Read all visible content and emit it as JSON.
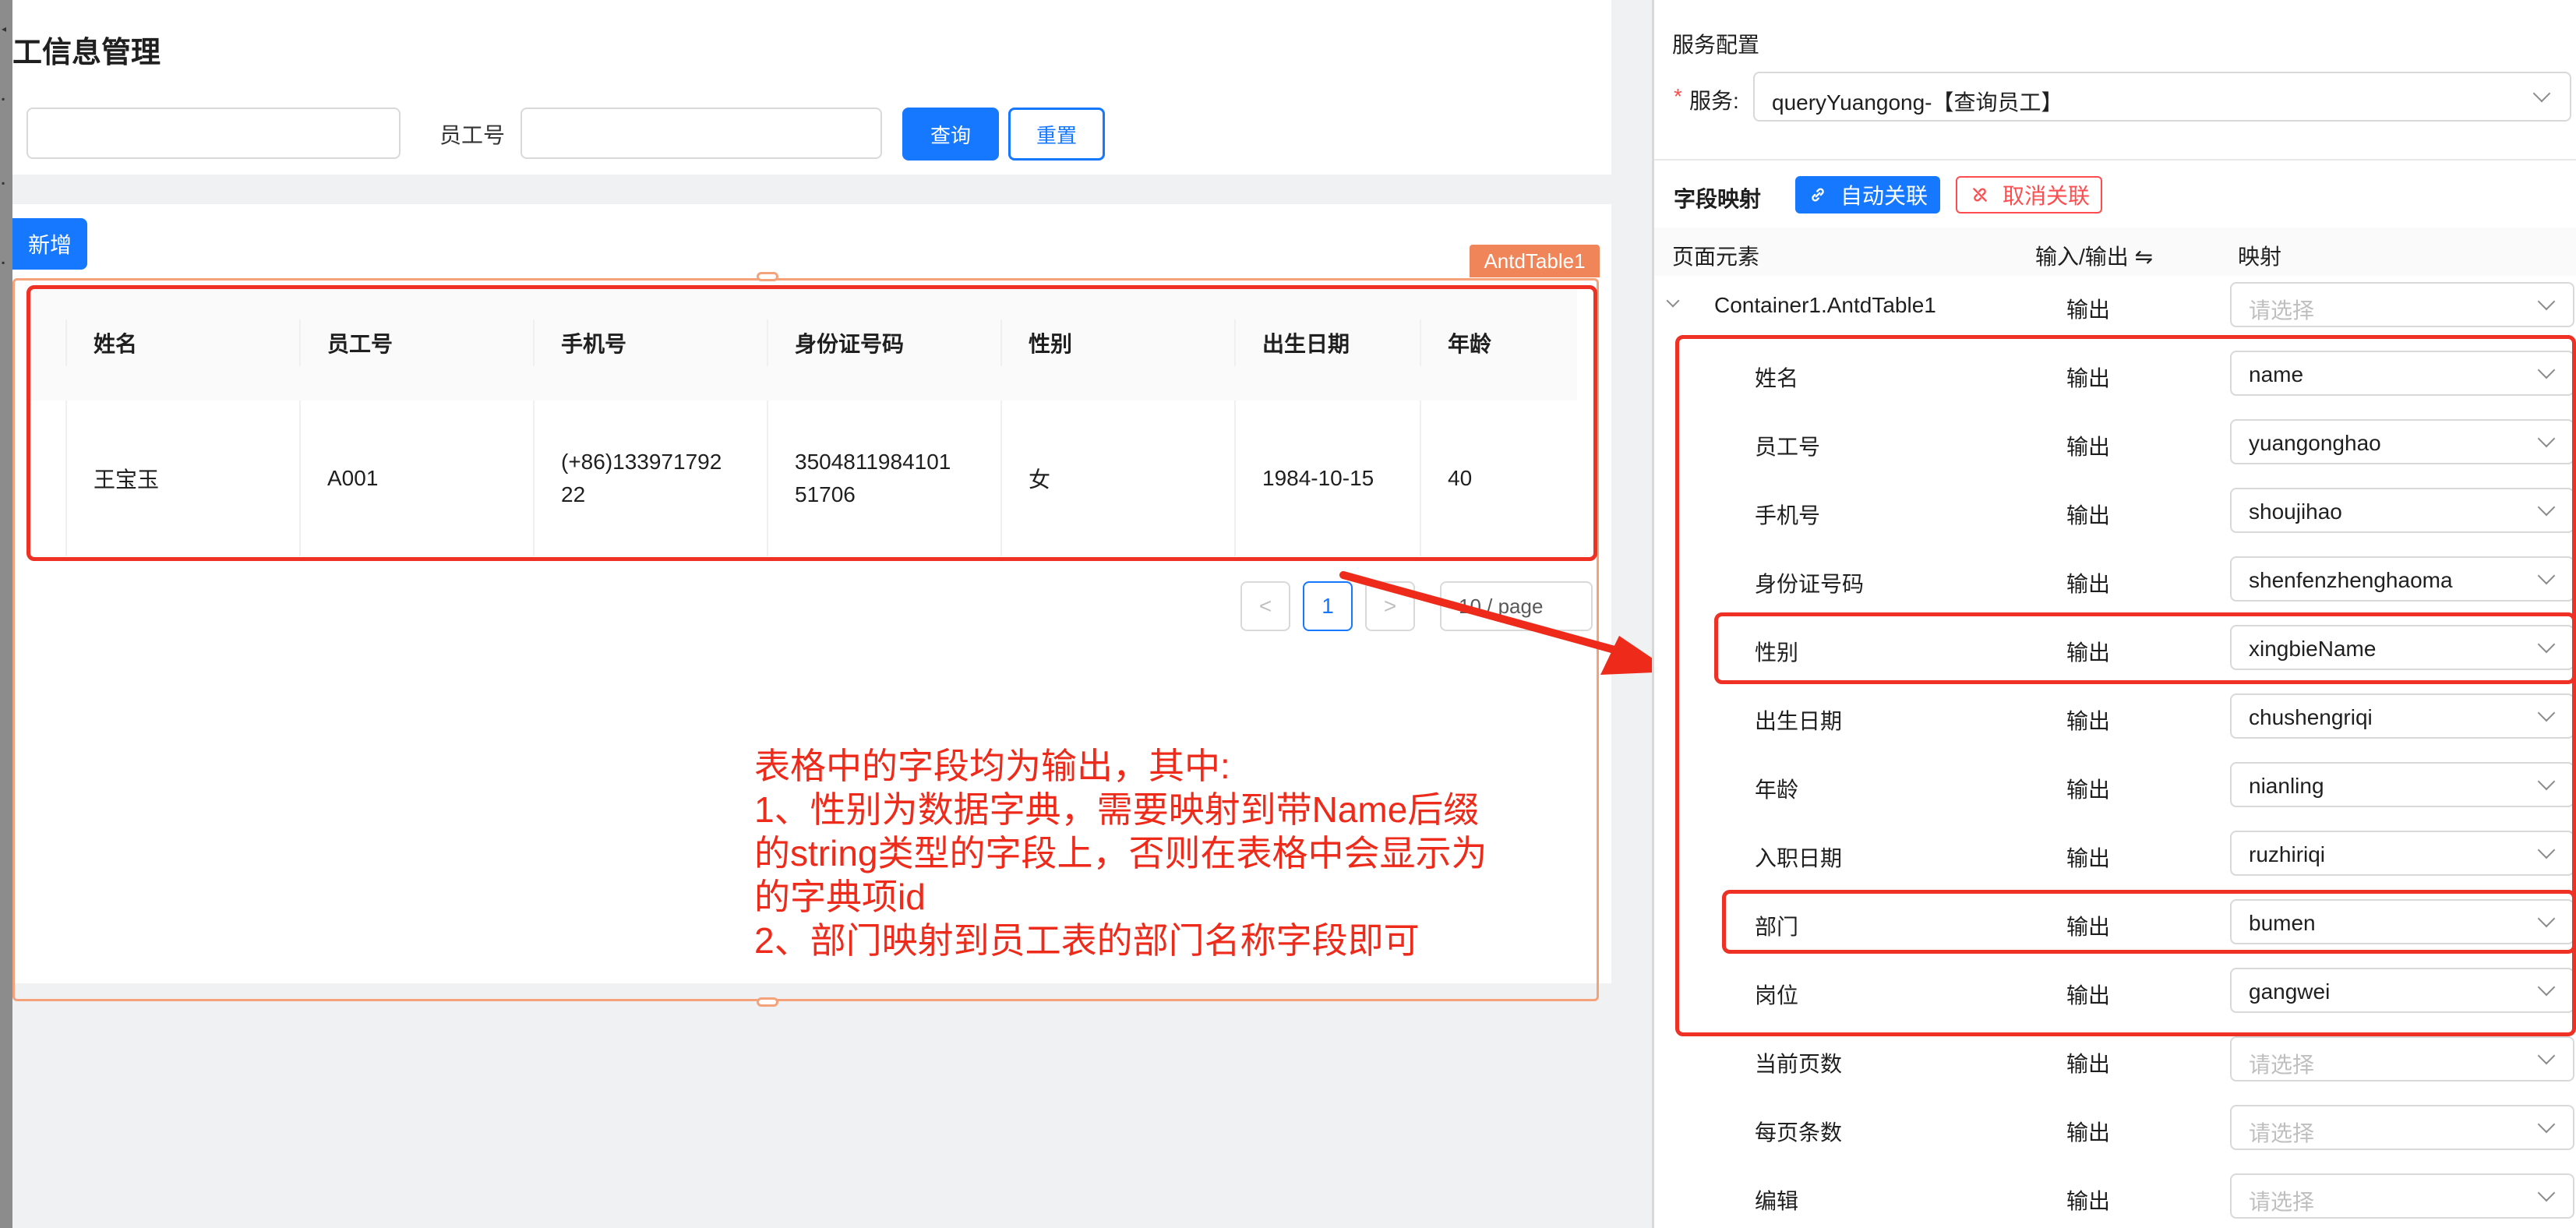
{
  "page": {
    "title": "工信息管理",
    "search": {
      "employee_no_label": "员工号",
      "query_button": "查询",
      "reset_button": "重置"
    },
    "new_button": "新增",
    "component_tag": "AntdTable1",
    "table": {
      "columns": [
        "姓名",
        "员工号",
        "手机号",
        "身份证号码",
        "性别",
        "出生日期",
        "年龄"
      ],
      "rows": [
        [
          "王宝玉",
          "A001",
          "(+86)133971792\n22",
          "3504811984101\n51706",
          "女",
          "1984-10-15",
          "40"
        ]
      ]
    },
    "pagination": {
      "prev": "<",
      "current": "1",
      "next": ">",
      "page_size": "10 / page"
    }
  },
  "annotation": {
    "text": "表格中的字段均为输出，其中:\n1、性别为数据字典，需要映射到带Name后缀\n的string类型的字段上，否则在表格中会显示为\n的字典项id\n2、部门映射到员工表的部门名称字段即可"
  },
  "panel": {
    "service_config_title": "服务配置",
    "service_label": "服务:",
    "service_required": "*",
    "service_value": "queryYuangong-【查询员工】",
    "field_mapping_title": "字段映射",
    "auto_link_button": "自动关联",
    "cancel_link_button": "取消关联",
    "headers": {
      "element": "页面元素",
      "io": "输入/输出 ⇋",
      "mapping": "映射"
    },
    "root": {
      "name": "Container1.AntdTable1",
      "io": "输出",
      "mapping": "请选择"
    },
    "rows": [
      {
        "name": "姓名",
        "io": "输出",
        "mapping": "name"
      },
      {
        "name": "员工号",
        "io": "输出",
        "mapping": "yuangonghao"
      },
      {
        "name": "手机号",
        "io": "输出",
        "mapping": "shoujihao"
      },
      {
        "name": "身份证号码",
        "io": "输出",
        "mapping": "shenfenzhenghaoma"
      },
      {
        "name": "性别",
        "io": "输出",
        "mapping": "xingbieName"
      },
      {
        "name": "出生日期",
        "io": "输出",
        "mapping": "chushengriqi"
      },
      {
        "name": "年龄",
        "io": "输出",
        "mapping": "nianling"
      },
      {
        "name": "入职日期",
        "io": "输出",
        "mapping": "ruzhiriqi"
      },
      {
        "name": "部门",
        "io": "输出",
        "mapping": "bumen"
      },
      {
        "name": "岗位",
        "io": "输出",
        "mapping": "gangwei"
      },
      {
        "name": "当前页数",
        "io": "输出",
        "mapping": "请选择"
      },
      {
        "name": "每页条数",
        "io": "输出",
        "mapping": "请选择"
      },
      {
        "name": "编辑",
        "io": "输出",
        "mapping": "请选择"
      }
    ]
  },
  "colors": {
    "primary": "#1677ff",
    "danger": "#ff4d4f",
    "annotation_red": "#ee2a1b",
    "selection_orange": "#f0855a"
  }
}
